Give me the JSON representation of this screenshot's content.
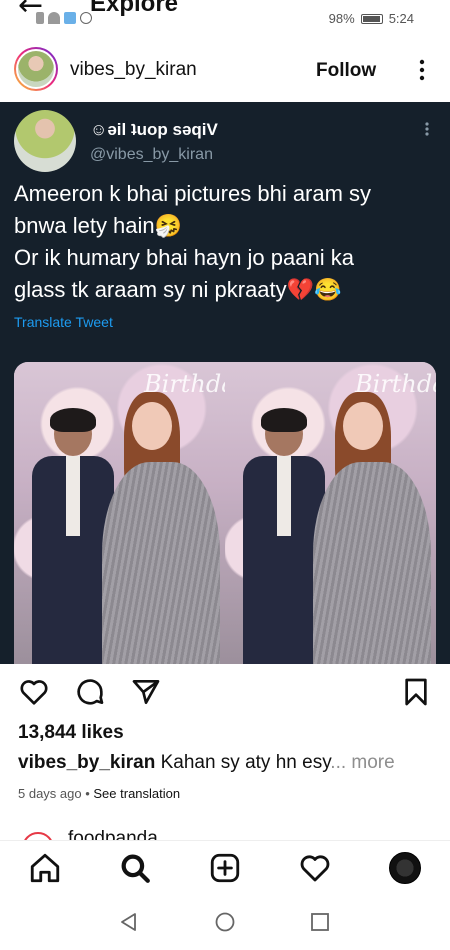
{
  "status_bar": {
    "page_title": "Explore",
    "battery": "98%",
    "time": "5:24"
  },
  "post": {
    "username": "vibes_by_kiran",
    "follow_label": "Follow",
    "more_icon": "more-vertical-icon"
  },
  "tweet": {
    "display_name": "☺əil ʇuop səqiV",
    "handle": "@vibes_by_kiran",
    "text_lines": [
      "Ameeron k bhai pictures bhi aram sy",
      "bnwa lety hain🤧",
      "Or ik humary bhai hayn jo paani ka",
      "glass tk araam sy ni pkraaty💔😂"
    ],
    "translate_label": "Translate Tweet",
    "watermark": "Birthday"
  },
  "actions": {
    "like_icon": "heart-icon",
    "comment_icon": "comment-icon",
    "share_icon": "send-icon",
    "save_icon": "bookmark-icon"
  },
  "likes_text": "13,844 likes",
  "caption": {
    "username": "vibes_by_kiran",
    "text": " Kahan sy aty hn esy",
    "more": "... more"
  },
  "meta": {
    "time_ago": "5 days ago",
    "separator": " • ",
    "see_translation": "See translation"
  },
  "next_post": {
    "username": "foodpanda"
  },
  "bottom_nav": [
    "home-icon",
    "search-icon",
    "create-icon",
    "activity-icon",
    "profile-avatar"
  ],
  "system_nav": [
    "back-triangle-icon",
    "home-circle-icon",
    "recents-square-icon"
  ],
  "colors": {
    "tweet_bg": "#15202b",
    "link_blue": "#1d9bf0",
    "muted": "#8899a6"
  }
}
